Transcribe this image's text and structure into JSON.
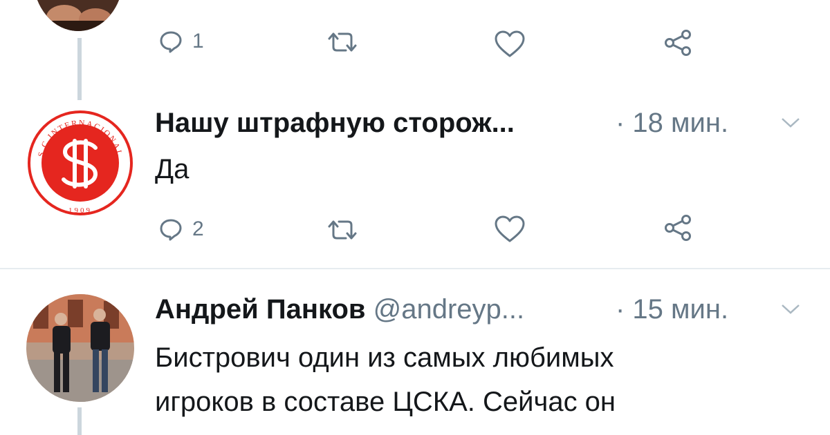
{
  "tweet1": {
    "reply_count": "1"
  },
  "tweet2": {
    "author": "Нашу штрафную сторож...",
    "time": "· 18 мин.",
    "text": "Да",
    "reply_count": "2",
    "avatar_text": "S.C.INTERNACIONAL",
    "avatar_year": "1909",
    "avatar_color": "#e5261f"
  },
  "tweet3": {
    "author": "Андрей Панков",
    "handle": "@andreyp...",
    "time": "· 15 мин.",
    "lines": [
      "Бистрович один из самых любимых",
      "игроков в составе ЦСКА. Сейчас он"
    ]
  },
  "colors": {
    "text": "#14171a",
    "secondary": "#657786",
    "thread": "#ccd6dd"
  }
}
